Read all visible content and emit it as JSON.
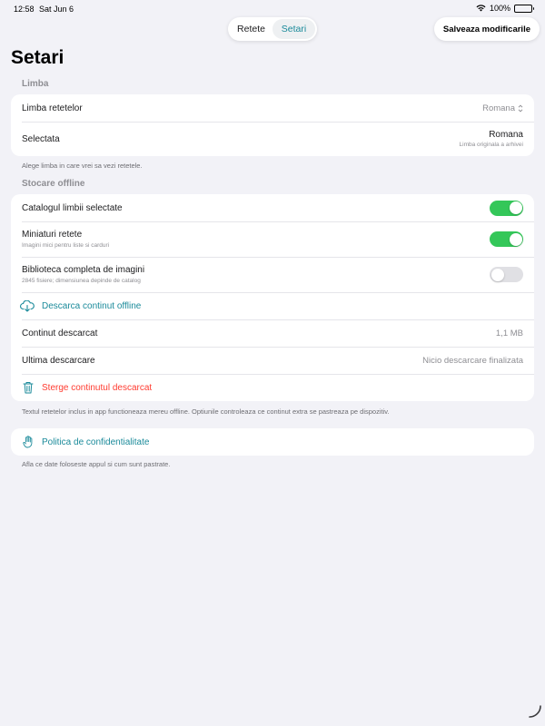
{
  "status_bar": {
    "time": "12:58",
    "date": "Sat Jun 6",
    "battery": "100%"
  },
  "nav": {
    "tabs": [
      {
        "label": "Retete",
        "active": false
      },
      {
        "label": "Setari",
        "active": true
      }
    ],
    "save_label": "Salveaza modificarile"
  },
  "page_title": "Setari",
  "language_section": {
    "header": "Limba",
    "recipe_language_label": "Limba retetelor",
    "recipe_language_value": "Romana",
    "selected_label": "Selectata",
    "selected_value": "Romana",
    "selected_subtitle": "Limba originala a arhivei",
    "footnote": "Alege limba in care vrei sa vezi retetele."
  },
  "offline_section": {
    "header": "Stocare offline",
    "catalog_label": "Catalogul limbii selectate",
    "catalog_on": true,
    "thumbnails_label": "Miniaturi retete",
    "thumbnails_subtitle": "Imagini mici pentru liste si carduri",
    "thumbnails_on": true,
    "library_label": "Biblioteca completa de imagini",
    "library_subtitle": "2845 fisiere; dimensiunea depinde de catalog",
    "library_on": false,
    "download_label": "Descarca continut offline",
    "downloaded_label": "Continut descarcat",
    "downloaded_value": "1,1 MB",
    "last_download_label": "Ultima descarcare",
    "last_download_value": "Nicio descarcare finalizata",
    "delete_label": "Sterge continutul descarcat",
    "footnote": "Textul retetelor inclus in app functioneaza mereu offline. Optiunile controleaza ce continut extra se pastreaza pe dispozitiv."
  },
  "privacy_section": {
    "link_label": "Politica de confidentialitate",
    "footnote": "Afla ce date foloseste appul si cum sunt pastrate."
  },
  "colors": {
    "accent": "#1a8a9a",
    "toggle_on": "#34c759",
    "destructive": "#ff3b30",
    "background": "#f2f2f7"
  }
}
